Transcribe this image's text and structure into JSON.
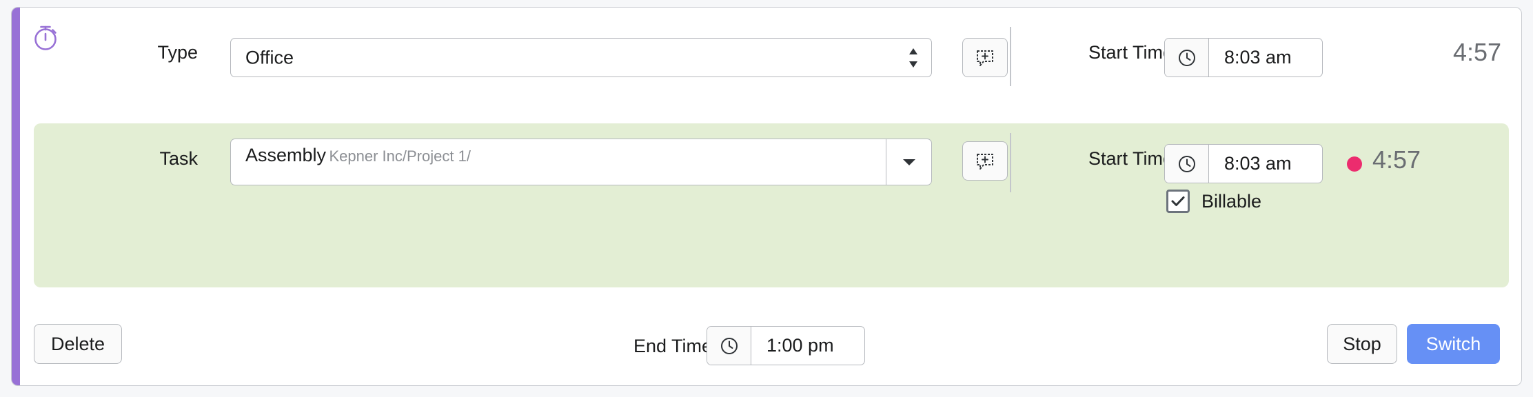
{
  "colors": {
    "accent_purple": "#9871d6",
    "active_row_green": "#e3eed4",
    "recording_dot_pink": "#ec2c6e",
    "primary_button_blue": "#6690f5",
    "page_background": "#f6f7f9",
    "muted_text": "#8b8e93",
    "elapsed_text": "#6a6d72"
  },
  "card": {
    "timer_icon": "stopwatch-icon"
  },
  "type_row": {
    "label": "Type",
    "select_value": "Office",
    "select_icon": "stepper-arrows-icon",
    "note_button_icon": "comment-add-icon",
    "start_time_label": "Start Time",
    "clock_icon": "clock-icon",
    "start_time_value": "8:03 am",
    "elapsed": "4:57"
  },
  "task_row": {
    "label": "Task",
    "task_title": "Assembly",
    "task_path": "Kepner Inc/Project 1/",
    "dropdown_icon": "chevron-down-icon",
    "note_button_icon": "comment-add-icon",
    "start_time_label": "Start Time",
    "clock_icon": "clock-icon",
    "start_time_value": "8:03 am",
    "elapsed": "4:57",
    "recording_indicator": "recording-dot-icon",
    "billable_label": "Billable",
    "billable_checked": true,
    "billable_icon": "checkmark-icon"
  },
  "footer": {
    "delete_label": "Delete",
    "end_time_label": "End Time",
    "end_time_clock_icon": "clock-icon",
    "end_time_value": "1:00 pm",
    "stop_label": "Stop",
    "switch_label": "Switch"
  }
}
